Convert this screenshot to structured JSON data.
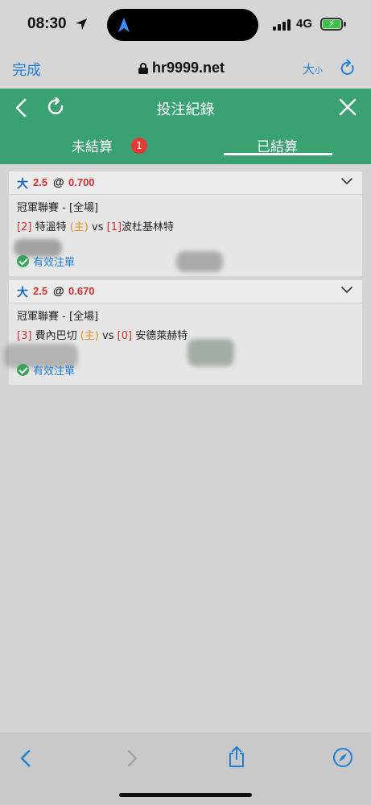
{
  "status_bar": {
    "time": "08:30",
    "network": "4G"
  },
  "browser": {
    "done_label": "完成",
    "url": "hr9999.net",
    "text_size_label": "大",
    "text_size_small": "小"
  },
  "header": {
    "title": "投注紀錄"
  },
  "tabs": [
    {
      "label": "未結算",
      "badge": "1",
      "active": false
    },
    {
      "label": "已結算",
      "active": true
    }
  ],
  "bets": [
    {
      "bet_type": "大",
      "line": "2.5",
      "at": "@",
      "odds": "0.700",
      "league": "冠軍聯賽 - [全場]",
      "home_rank": "[2]",
      "home_team": "特溫特",
      "home_tag": "(主)",
      "vs": "vs",
      "away_rank": "[1]",
      "away_team": "波杜基林特",
      "status": "有效注單"
    },
    {
      "bet_type": "大",
      "line": "2.5",
      "at": "@",
      "odds": "0.670",
      "league": "冠軍聯賽 - [全場]",
      "home_rank": "[3]",
      "home_team": "費內巴切",
      "home_tag": "(主)",
      "vs": "vs",
      "away_rank": "[0]",
      "away_team": "安德萊赫特",
      "status": "有效注單"
    }
  ],
  "colors": {
    "header_green": "#3aa173",
    "accent_blue": "#1e7fd8",
    "odds_red": "#d32f2f",
    "home_orange": "#e0901a",
    "badge_red": "#e53935"
  }
}
